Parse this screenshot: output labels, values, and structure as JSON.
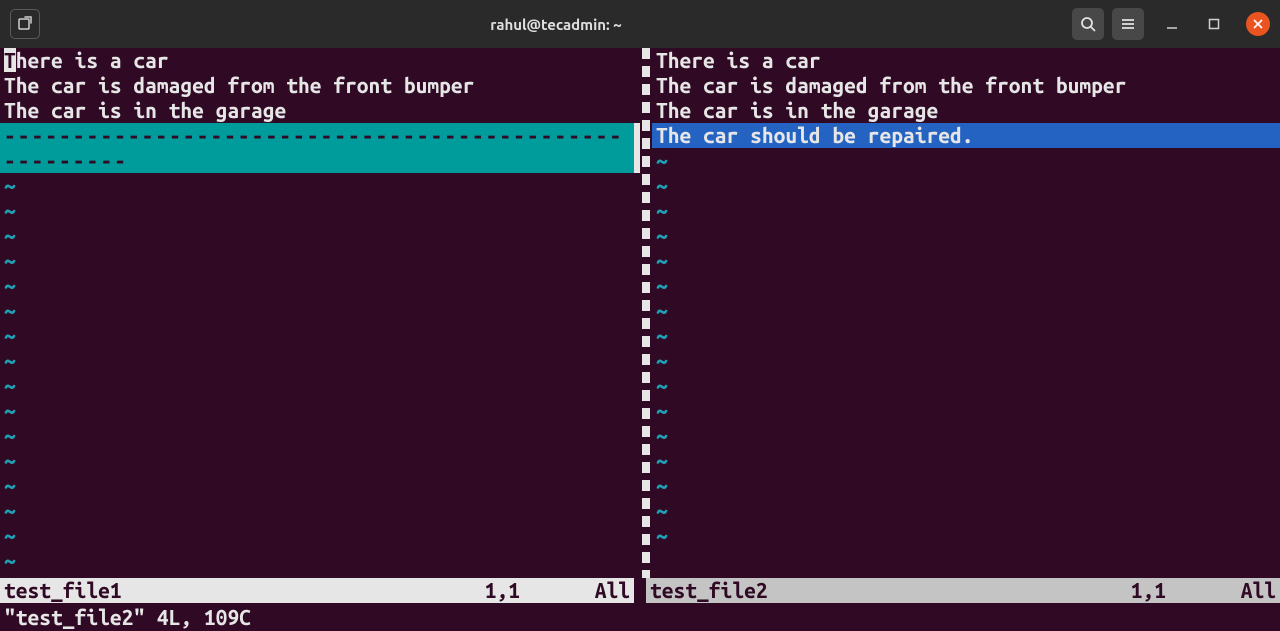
{
  "window": {
    "title": "rahul@tecadmin: ~"
  },
  "icons": {
    "newtab": "new-tab-icon",
    "search": "search-icon",
    "menu": "menu-icon",
    "minimize": "minimize-icon",
    "maximize": "maximize-icon",
    "close": "close-icon"
  },
  "editor": {
    "left": {
      "filename": "test_file1",
      "lines": [
        "There is a car",
        "The car is damaged from the front bumper",
        "The car is in the garage"
      ],
      "diff_line": "------------------------------------------------------",
      "cursor": "1,1",
      "scroll": "All",
      "active": true
    },
    "right": {
      "filename": "test_file2",
      "lines": [
        "There is a car",
        "The car is damaged from the front bumper",
        "The car is in the garage",
        "The car should be repaired."
      ],
      "cursor": "1,1",
      "scroll": "All",
      "active": false
    },
    "tilde": "~",
    "cmdline": "\"test_file2\" 4L, 109C"
  }
}
